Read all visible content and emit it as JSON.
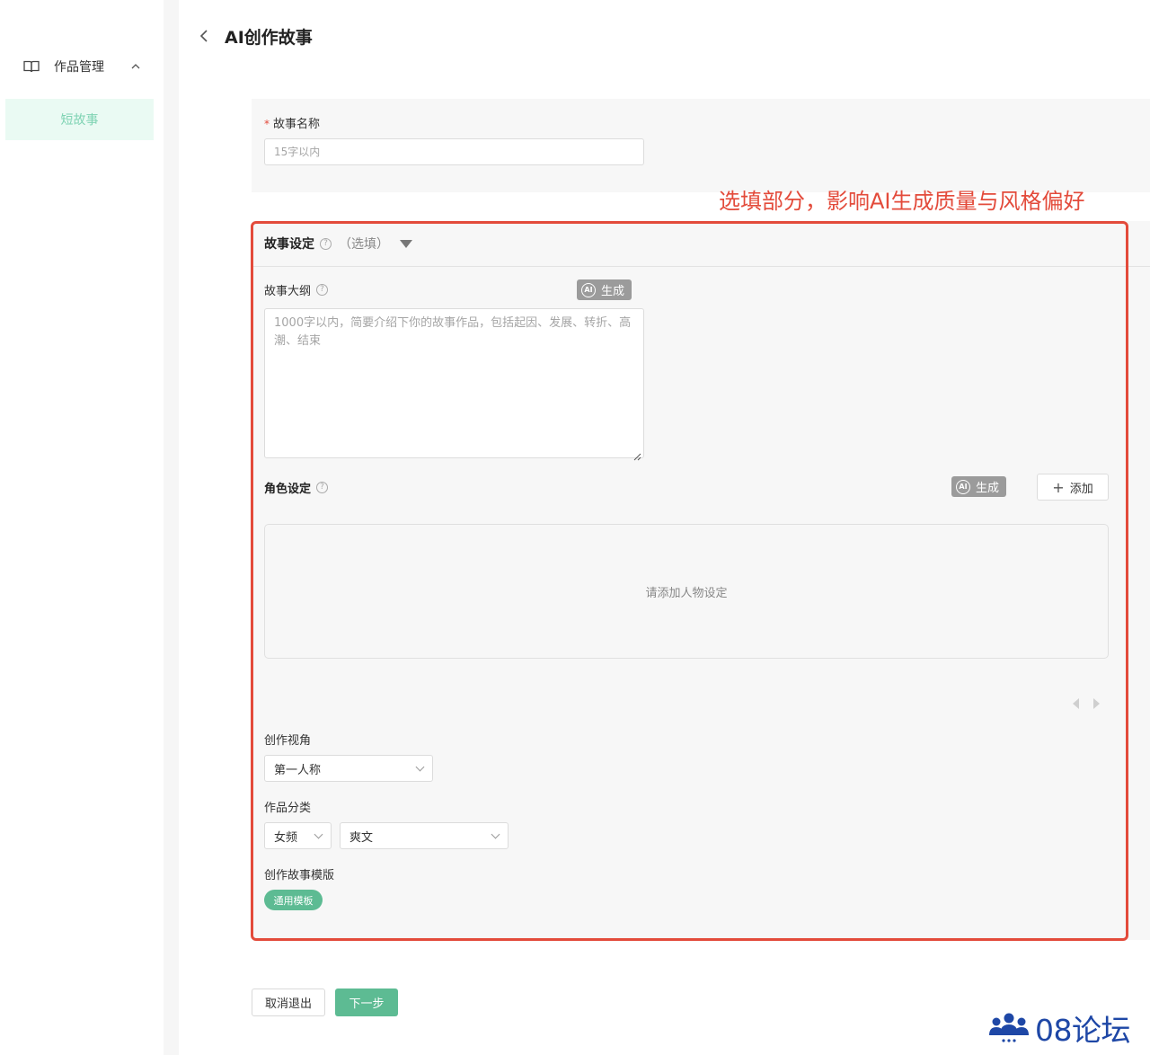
{
  "sidebar": {
    "group_label": "作品管理",
    "active_item": "短故事"
  },
  "header": {
    "title": "AI创作故事"
  },
  "form": {
    "name_required_mark": "*",
    "name_label": "故事名称",
    "name_placeholder": "15字以内"
  },
  "annotation": "选填部分，影响AI生成质量与风格偏好",
  "settings": {
    "title": "故事设定",
    "optional": "（选填）",
    "outline_label": "故事大纲",
    "outline_placeholder": "1000字以内，简要介绍下你的故事作品，包括起因、发展、转折、高潮、结束",
    "ai_badge": "AI",
    "ai_generate": "生成",
    "role_label": "角色设定",
    "add_label": "添加",
    "role_empty": "请添加人物设定",
    "pov_label": "创作视角",
    "pov_value": "第一人称",
    "category_label": "作品分类",
    "category_primary": "女频",
    "category_secondary": "爽文",
    "template_label": "创作故事模版",
    "template_tag": "通用模板"
  },
  "footer": {
    "cancel": "取消退出",
    "next": "下一步"
  },
  "watermark": "08论坛",
  "colors": {
    "accent": "#5dbb93",
    "annotation": "#e34b3b",
    "watermark": "#1e47a6"
  }
}
